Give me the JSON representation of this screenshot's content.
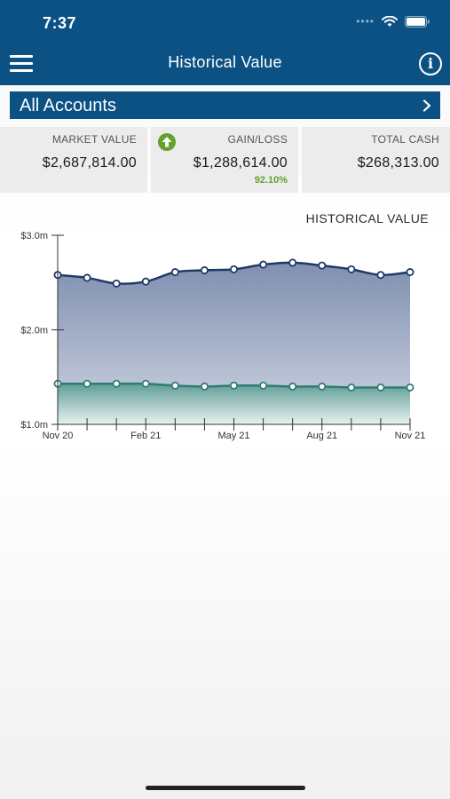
{
  "status_bar": {
    "time": "7:37"
  },
  "nav": {
    "title": "Historical Value",
    "menu_icon": "hamburger-menu-icon",
    "info_icon": "info-icon"
  },
  "account_selector": {
    "label": "All Accounts",
    "chevron_icon": "chevron-right-icon"
  },
  "summary": {
    "market_value": {
      "label": "MARKET VALUE",
      "value": "$2,687,814.00"
    },
    "gain_loss": {
      "label": "GAIN/LOSS",
      "value": "$1,288,614.00",
      "percent": "92.10%",
      "icon": "arrow-up-circle-icon"
    },
    "total_cash": {
      "label": "TOTAL CASH",
      "value": "$268,313.00"
    }
  },
  "colors": {
    "brand": "#0b5184",
    "positive": "#63a02c",
    "series_upper": "#1f3a66",
    "series_lower": "#2e7c73"
  },
  "chart_data": {
    "type": "area",
    "title": "HISTORICAL VALUE",
    "ylim": [
      1.0,
      3.0
    ],
    "y_ticks": [
      {
        "value": 1.0,
        "label": "$1.0m"
      },
      {
        "value": 2.0,
        "label": "$2.0m"
      },
      {
        "value": 3.0,
        "label": "$3.0m"
      }
    ],
    "x_count": 13,
    "x_tick_labels": [
      {
        "index": 0,
        "label": "Nov 20"
      },
      {
        "index": 3,
        "label": "Feb 21"
      },
      {
        "index": 6,
        "label": "May 21"
      },
      {
        "index": 9,
        "label": "Aug 21"
      },
      {
        "index": 12,
        "label": "Nov 21"
      }
    ],
    "series": [
      {
        "values": [
          2.58,
          2.55,
          2.49,
          2.51,
          2.61,
          2.63,
          2.64,
          2.69,
          2.71,
          2.68,
          2.64,
          2.58,
          2.61
        ]
      },
      {
        "values": [
          1.43,
          1.43,
          1.43,
          1.43,
          1.41,
          1.4,
          1.41,
          1.41,
          1.4,
          1.4,
          1.39,
          1.39,
          1.39
        ]
      }
    ]
  }
}
